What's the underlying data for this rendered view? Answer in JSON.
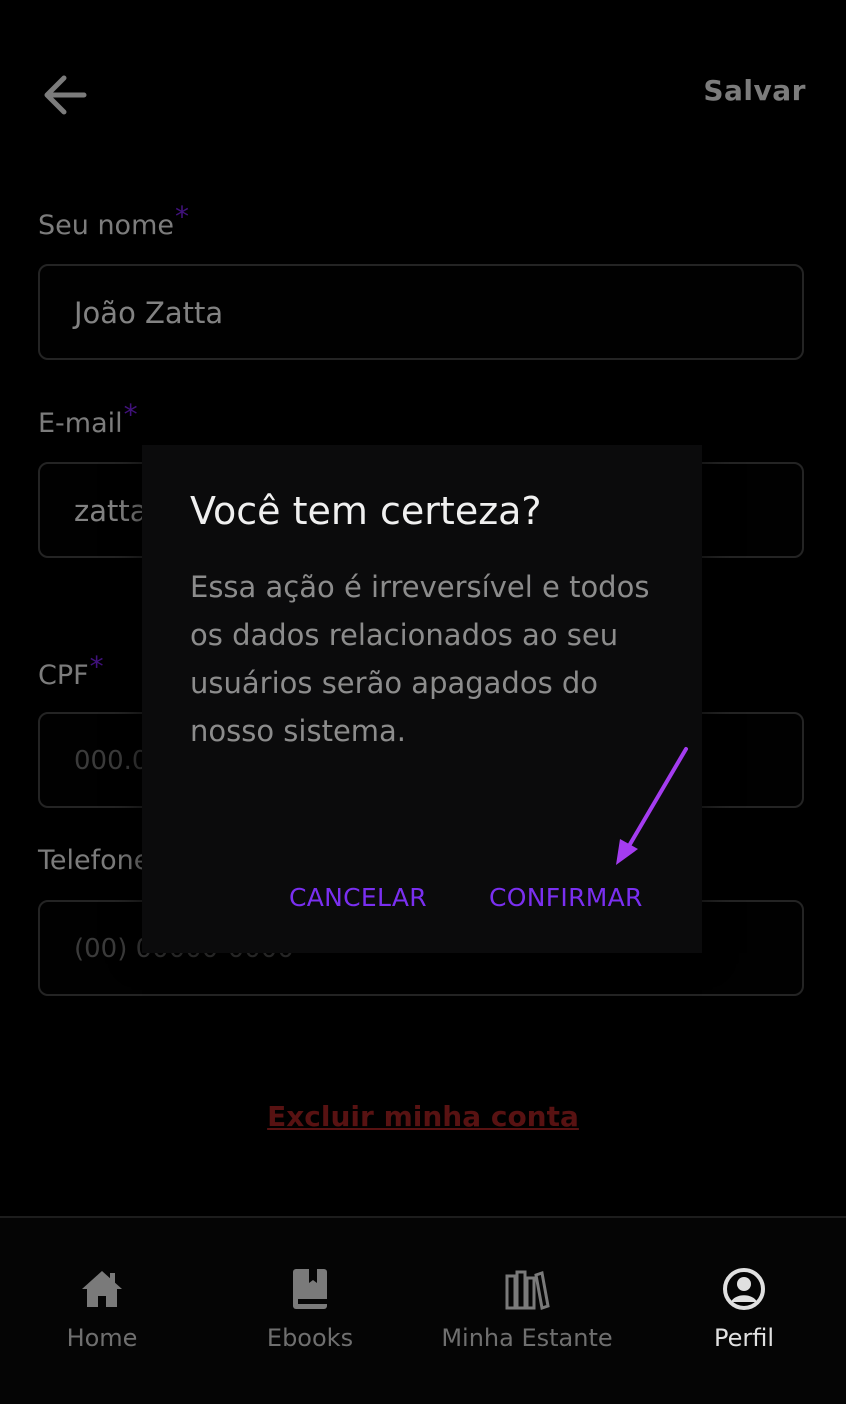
{
  "header": {
    "save_label": "Salvar"
  },
  "form": {
    "name": {
      "label": "Seu nome",
      "required_mark": "*",
      "value": "João Zatta"
    },
    "email": {
      "label": "E-mail",
      "required_mark": "*",
      "value": "zatta"
    },
    "cpf": {
      "label": "CPF",
      "required_mark": "*",
      "placeholder": "000.0"
    },
    "phone": {
      "label": "Telefone",
      "placeholder": "(00) 00000-0000"
    }
  },
  "delete_account": "Excluir minha conta",
  "dialog": {
    "title": "Você tem certeza?",
    "message": "Essa ação é irreversível e todos os dados relacionados ao seu usuários serão apagados do nosso sistema.",
    "cancel_label": "CANCELAR",
    "confirm_label": "CONFIRMAR"
  },
  "bottom_nav": {
    "items": [
      {
        "label": "Home",
        "icon": "home-icon"
      },
      {
        "label": "Ebooks",
        "icon": "book-icon"
      },
      {
        "label": "Minha Estante",
        "icon": "bookshelf-icon"
      },
      {
        "label": "Perfil",
        "icon": "profile-icon",
        "active": true
      }
    ]
  },
  "colors": {
    "accent": "#7a2ff0",
    "annotation_arrow": "#a43cf0",
    "danger": "#8f1d1d",
    "background": "#000000"
  }
}
